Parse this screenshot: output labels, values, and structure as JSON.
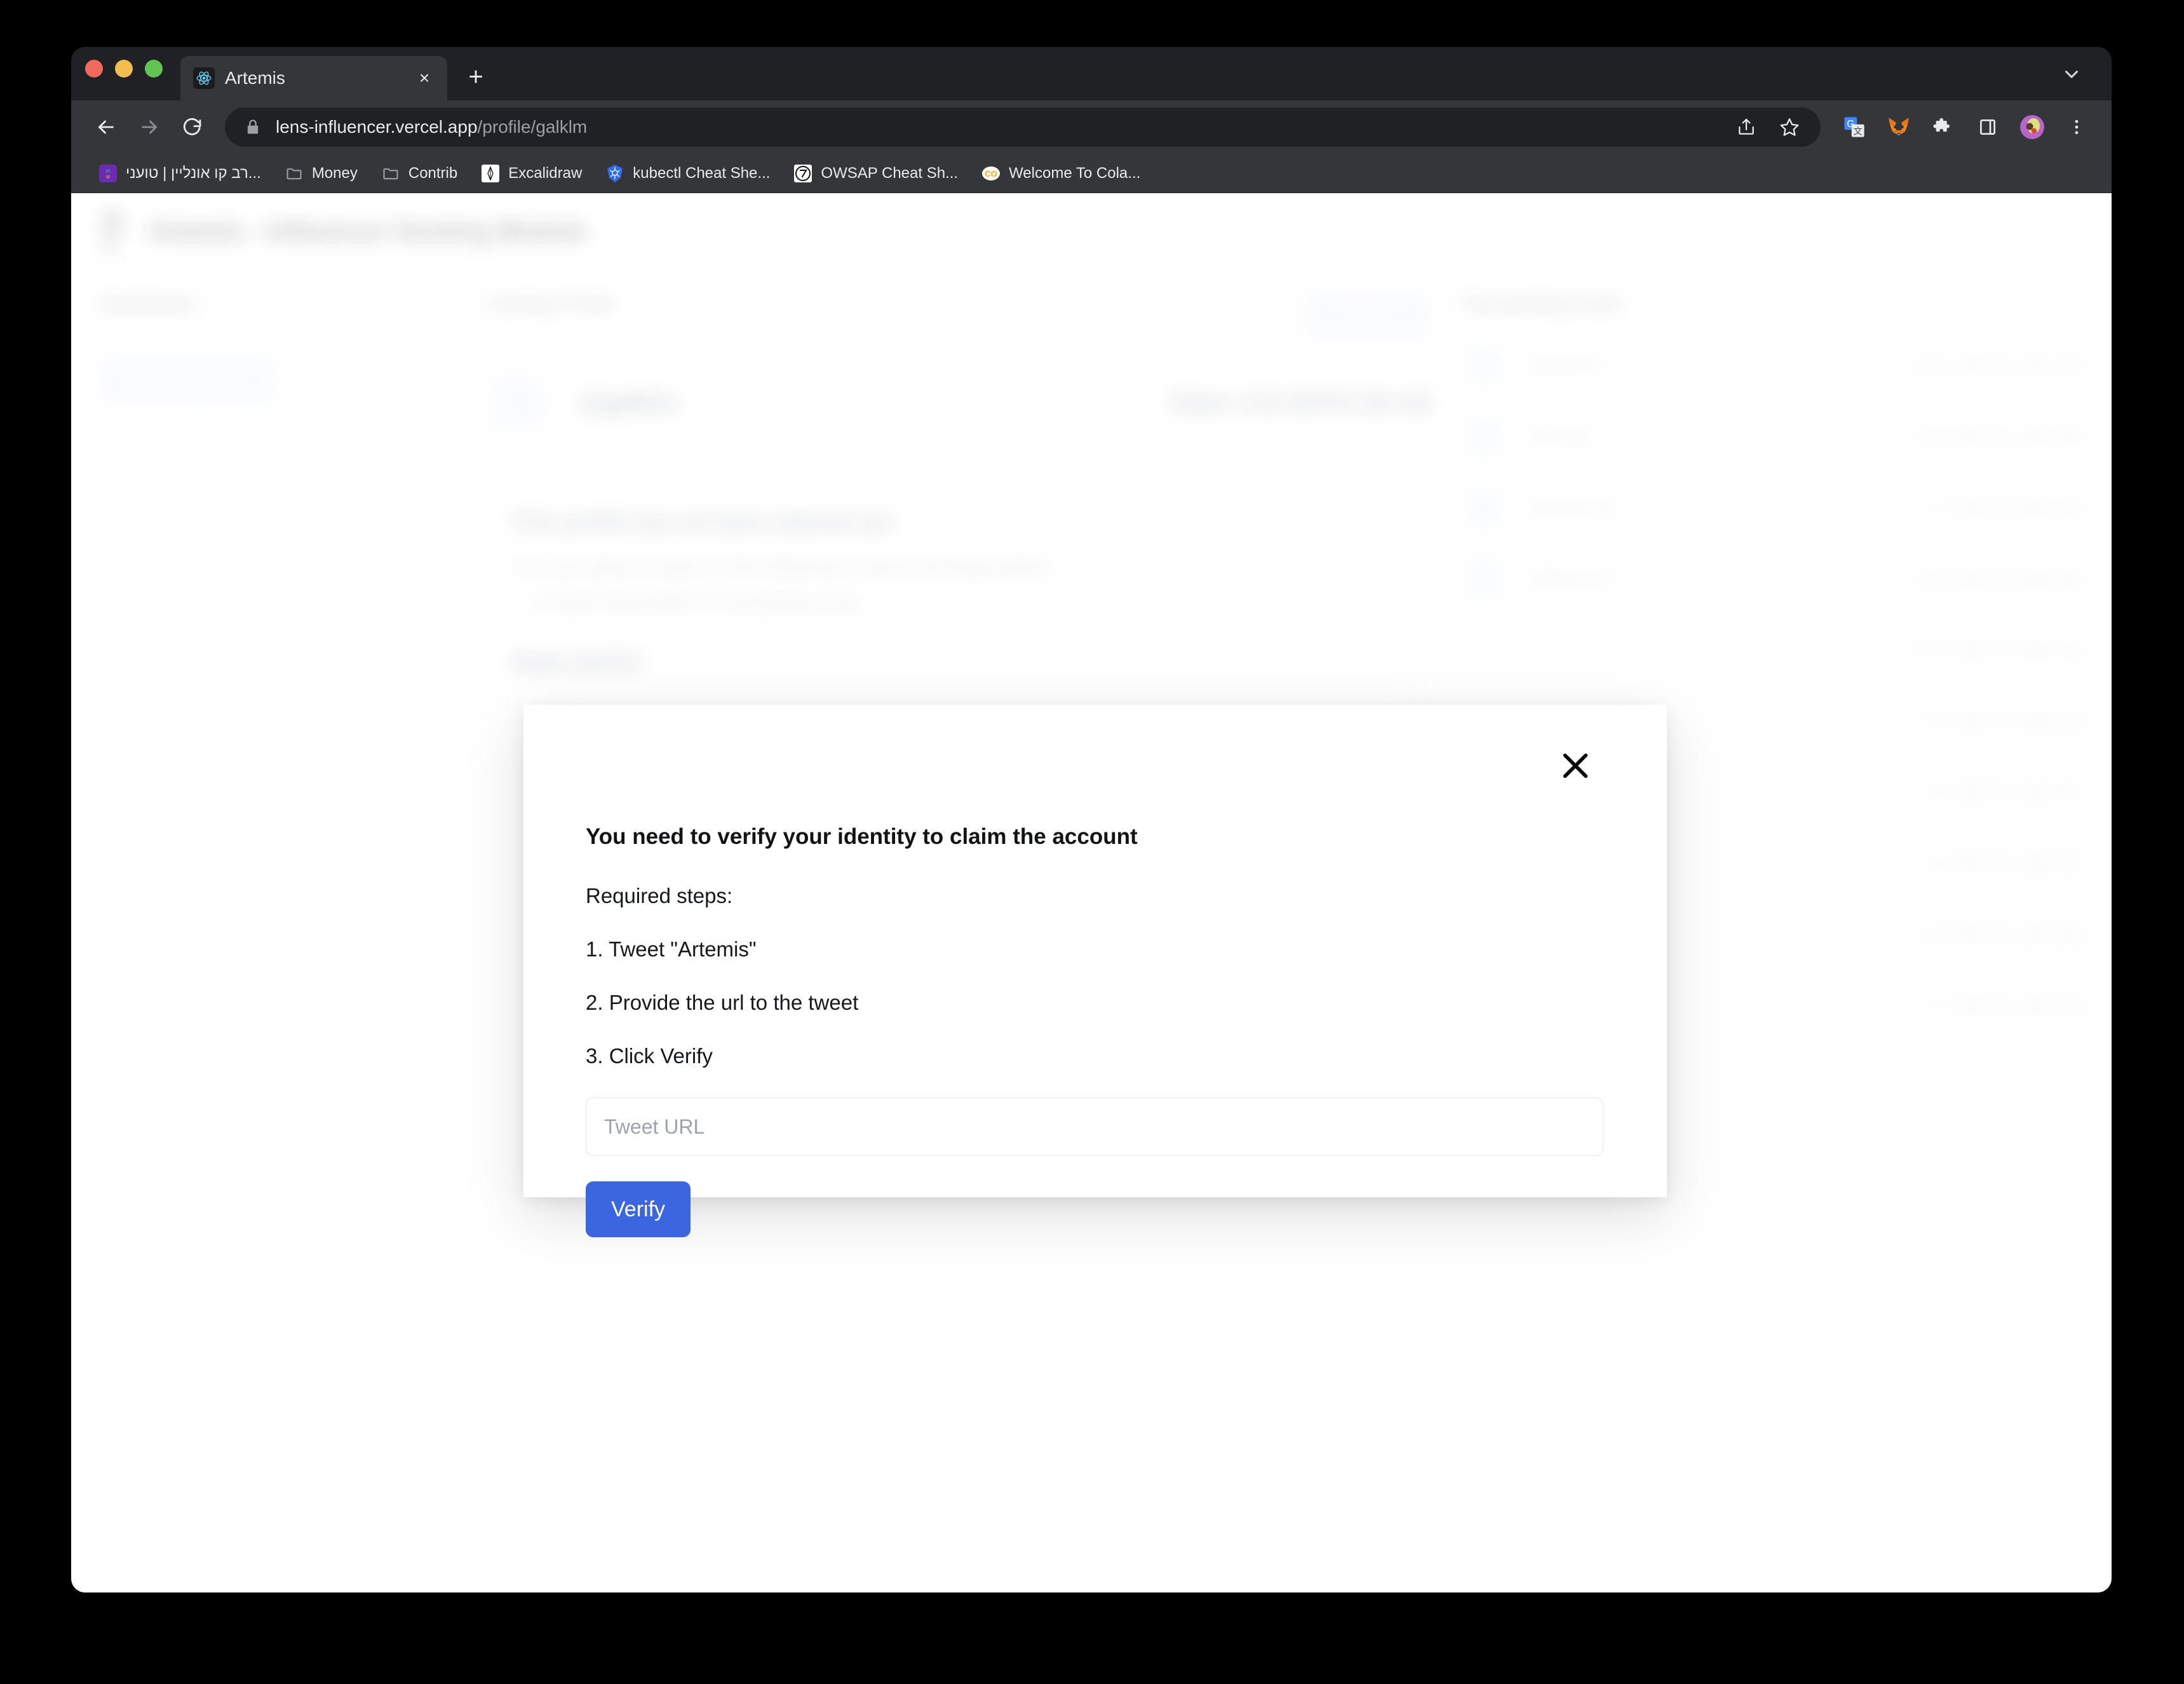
{
  "browser": {
    "tab": {
      "title": "Artemis",
      "favicon": "react-logo-icon",
      "close_label": "×"
    },
    "new_tab_label": "+",
    "tabstrip_chevron": "chevron-down-icon",
    "nav": {
      "back": "back-arrow-icon",
      "forward": "forward-arrow-icon",
      "reload": "reload-icon"
    },
    "omnibox": {
      "lock": "lock-icon",
      "url_host": "lens-influencer.vercel.app",
      "url_path": "/profile/galklm",
      "share": "share-icon",
      "bookmark": "star-icon"
    },
    "extensions": [
      {
        "name": "google-translate-icon",
        "label": "G"
      },
      {
        "name": "metamask-fox-icon",
        "label": ""
      },
      {
        "name": "puzzle-extensions-icon",
        "label": ""
      },
      {
        "name": "side-panel-icon",
        "label": ""
      },
      {
        "name": "profile-avatar-icon",
        "label": ""
      },
      {
        "name": "kebab-menu-icon",
        "label": "⋮"
      }
    ],
    "bookmarks": [
      {
        "label": "רב קו אונליין | טועני...",
        "icon": "ravkav-icon"
      },
      {
        "label": "Money",
        "icon": "folder-icon"
      },
      {
        "label": "Contrib",
        "icon": "folder-icon"
      },
      {
        "label": "Excalidraw",
        "icon": "excalidraw-icon"
      },
      {
        "label": "kubectl Cheat She...",
        "icon": "kubernetes-icon"
      },
      {
        "label": "OWSAP Cheat Sh...",
        "icon": "owasp-icon"
      },
      {
        "label": "Welcome To Cola...",
        "icon": "colab-icon"
      }
    ]
  },
  "page": {
    "header": {
      "logo": "archer-icon",
      "title": "Artemis - Influencer Hunting Module"
    },
    "left": {
      "heading": "Dashboard",
      "create_profile_label": "Create Profile"
    },
    "middle": {
      "heading": "Hunting Profile",
      "claim_label": "Claim",
      "avatar_letter": "G",
      "handle": "@galklm",
      "stake_summary": "Stake: 0.91 MATIC ($1.44)",
      "card_title": "This profile has not been claimed yet",
      "card_line1": "You can stake to share in this influencer's future earnings below ...",
      "card_line2": "... or claim this profile if it should be yours.",
      "stake_field_label": "Stake MATIC"
    },
    "right": {
      "heading": "Top pending hunts",
      "rows": [
        {
          "avatar": "G",
          "handle": "@galklm",
          "badge": "",
          "amount": "0.91 MATIC ($1.44)"
        },
        {
          "avatar": "R",
          "handle": "@roger",
          "badge": "",
          "amount": "0.24 MATIC ($0.38)"
        },
        {
          "avatar": "M",
          "handle": "@maurice",
          "badge": "",
          "amount": "0.1 MATIC ($0.16)"
        },
        {
          "avatar": "F",
          "handle": "@famous",
          "badge": "",
          "amount": "0.03 MATIC ($0.05)"
        },
        {
          "avatar": "",
          "handle": "",
          "badge": "",
          "amount": "0.02 MATIC ($0.03)"
        },
        {
          "avatar": "",
          "handle": "",
          "badge": "",
          "amount": "0.0 MATIC ($0.00)"
        },
        {
          "avatar": "",
          "handle": "",
          "badge": "claimed",
          "amount": "0.3 MATIC ($0.47)"
        },
        {
          "avatar": "",
          "handle": "",
          "badge": "claimed",
          "amount": "0.2 MATIC ($0.32)"
        },
        {
          "avatar": "",
          "handle": "",
          "badge": "claimed",
          "amount": "0.18 MATIC ($0.28)"
        },
        {
          "avatar": "",
          "handle": "",
          "badge": "claimed",
          "amount": "0.1 MATIC ($0.16)"
        }
      ]
    }
  },
  "modal": {
    "close_label": "✕",
    "title": "You need to verify your identity to claim the account",
    "steps_lead": "Required steps:",
    "steps": [
      "1. Tweet \"Artemis\"",
      "2. Provide the url to the tweet",
      "3. Click Verify"
    ],
    "input_placeholder": "Tweet URL",
    "input_value": "",
    "verify_label": "Verify"
  },
  "colors": {
    "accent_blue": "#3b66e0",
    "soft_blue_bg": "#eef2ff",
    "chrome_dark": "#202124",
    "chrome_toolbar": "#35363a"
  }
}
